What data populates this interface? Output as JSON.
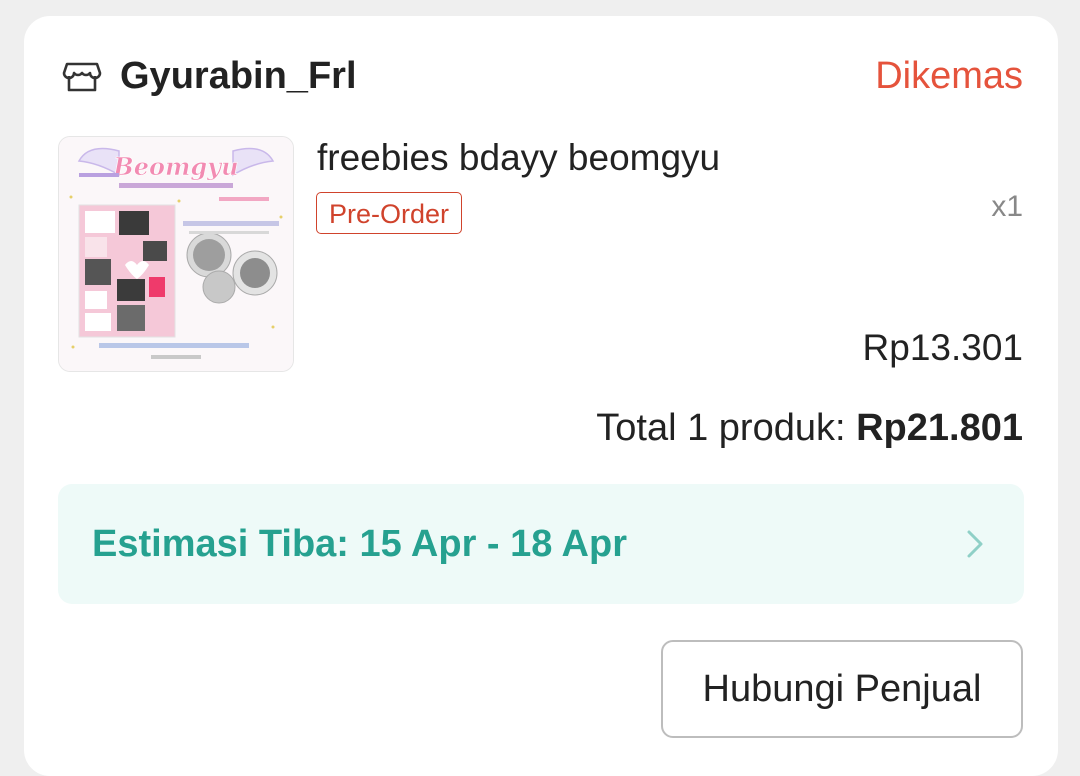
{
  "order": {
    "shop_icon": "shop-icon",
    "shop_name": "Gyurabin_Frl",
    "status": "Dikemas",
    "status_color": "#e5533c",
    "product": {
      "name": "freebies bdayy beomgyu",
      "badge": "Pre-Order",
      "quantity": "x1",
      "price": "Rp13.301",
      "image_title": "Beomgyu"
    },
    "total": {
      "label": "Total 1 produk:",
      "amount": "Rp21.801"
    },
    "delivery": {
      "estimate": "Estimasi Tiba: 15 Apr - 18 Apr",
      "accent_color": "#26a190"
    },
    "actions": {
      "contact_seller": "Hubungi Penjual"
    }
  }
}
